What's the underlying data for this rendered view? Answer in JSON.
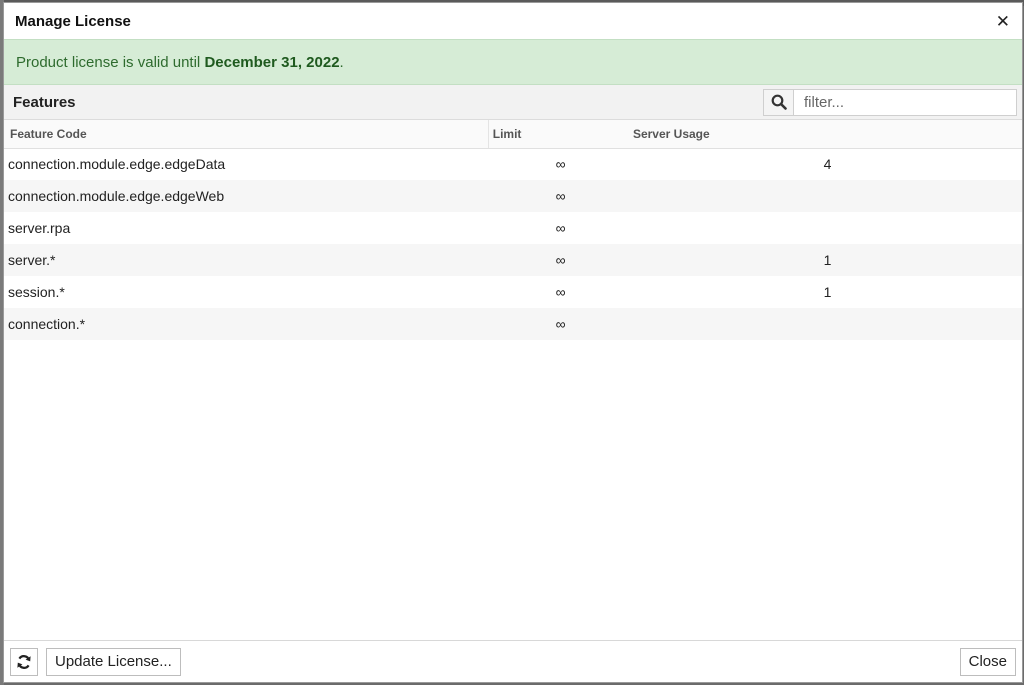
{
  "dialog": {
    "title": "Manage License",
    "close_glyph": "✕"
  },
  "alert": {
    "prefix": "Product license is valid until ",
    "date": "December 31, 2022",
    "suffix": "."
  },
  "features": {
    "heading": "Features",
    "filter_placeholder": "filter...",
    "search_icon": "search-icon"
  },
  "table": {
    "columns": [
      "Feature Code",
      "Limit",
      "Server Usage"
    ],
    "rows": [
      {
        "code": "connection.module.edge.edgeData",
        "limit": "∞",
        "usage": "4"
      },
      {
        "code": "connection.module.edge.edgeWeb",
        "limit": "∞",
        "usage": ""
      },
      {
        "code": "server.rpa",
        "limit": "∞",
        "usage": ""
      },
      {
        "code": "server.*",
        "limit": "∞",
        "usage": "1"
      },
      {
        "code": "session.*",
        "limit": "∞",
        "usage": "1"
      },
      {
        "code": "connection.*",
        "limit": "∞",
        "usage": ""
      }
    ]
  },
  "footer": {
    "refresh_icon": "refresh-icon",
    "update_label": "Update License...",
    "close_label": "Close"
  },
  "colors": {
    "alert_bg": "#d6ecd6",
    "alert_text": "#2e6b2e"
  }
}
